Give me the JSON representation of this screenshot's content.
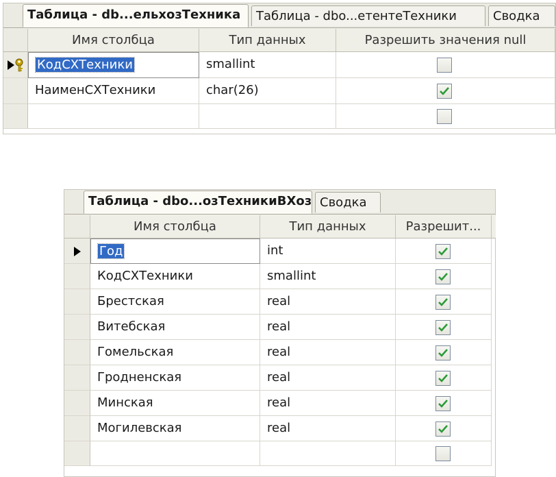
{
  "panel1": {
    "tabs": [
      {
        "label": "Таблица - db...ельхозТехника",
        "active": true
      },
      {
        "label": "Таблица - dbo...етентеТехники",
        "active": false
      },
      {
        "label": "Сводка",
        "active": false
      }
    ],
    "headers": {
      "name": "Имя столбца",
      "type": "Тип данных",
      "nulls": "Разрешить значения null"
    },
    "rows": [
      {
        "name": "КодСХТехники",
        "type": "smallint",
        "allow_null": false,
        "primary_key": true,
        "current": true
      },
      {
        "name": "НаименСХТехники",
        "type": "char(26)",
        "allow_null": true
      },
      {
        "name": "",
        "type": "",
        "allow_null": false
      }
    ]
  },
  "panel2": {
    "tabs": [
      {
        "label": "Таблица - dbo...озТехникиВХоз",
        "active": true
      },
      {
        "label": "Сводка",
        "active": false
      }
    ],
    "headers": {
      "name": "Имя столбца",
      "type": "Тип данных",
      "nulls": "Разрешит..."
    },
    "rows": [
      {
        "name": "Год",
        "type": "int",
        "allow_null": true,
        "current": true
      },
      {
        "name": "КодСХТехники",
        "type": "smallint",
        "allow_null": true
      },
      {
        "name": "Брестская",
        "type": "real",
        "allow_null": true
      },
      {
        "name": "Витебская",
        "type": "real",
        "allow_null": true
      },
      {
        "name": "Гомельская",
        "type": "real",
        "allow_null": true
      },
      {
        "name": "Гродненская",
        "type": "real",
        "allow_null": true
      },
      {
        "name": "Минская",
        "type": "real",
        "allow_null": true
      },
      {
        "name": "Могилевская",
        "type": "real",
        "allow_null": true
      },
      {
        "name": "",
        "type": "",
        "allow_null": false
      }
    ]
  },
  "colors": {
    "selection": "#316ac5",
    "check": "#2e9a3a",
    "key": "#c9a400"
  }
}
